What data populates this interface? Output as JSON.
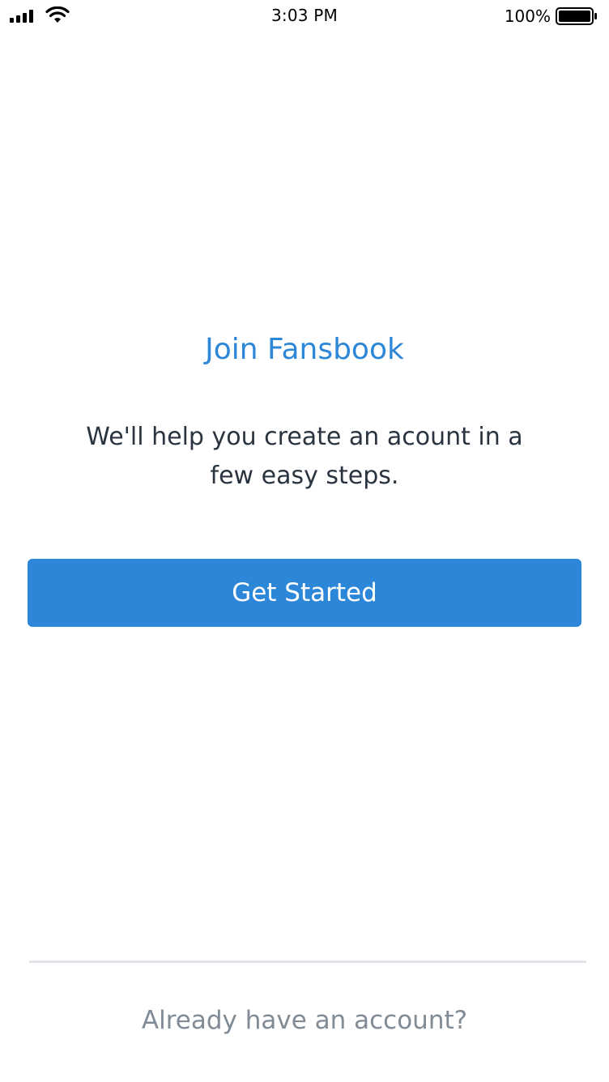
{
  "status_bar": {
    "time": "3:03 PM",
    "battery_percent": "100%",
    "icons": [
      "signal-icon",
      "wifi-icon",
      "battery-icon"
    ]
  },
  "onboarding": {
    "title": "Join Fansbook",
    "subtitle": "We'll help you create an acount in a few easy steps.",
    "primary_button": "Get Started",
    "secondary_link": "Already have an account?"
  },
  "colors": {
    "accent": "#2d87d8",
    "body_text": "#2a3440",
    "muted_text": "#808b96",
    "divider": "#e1e5e9"
  }
}
